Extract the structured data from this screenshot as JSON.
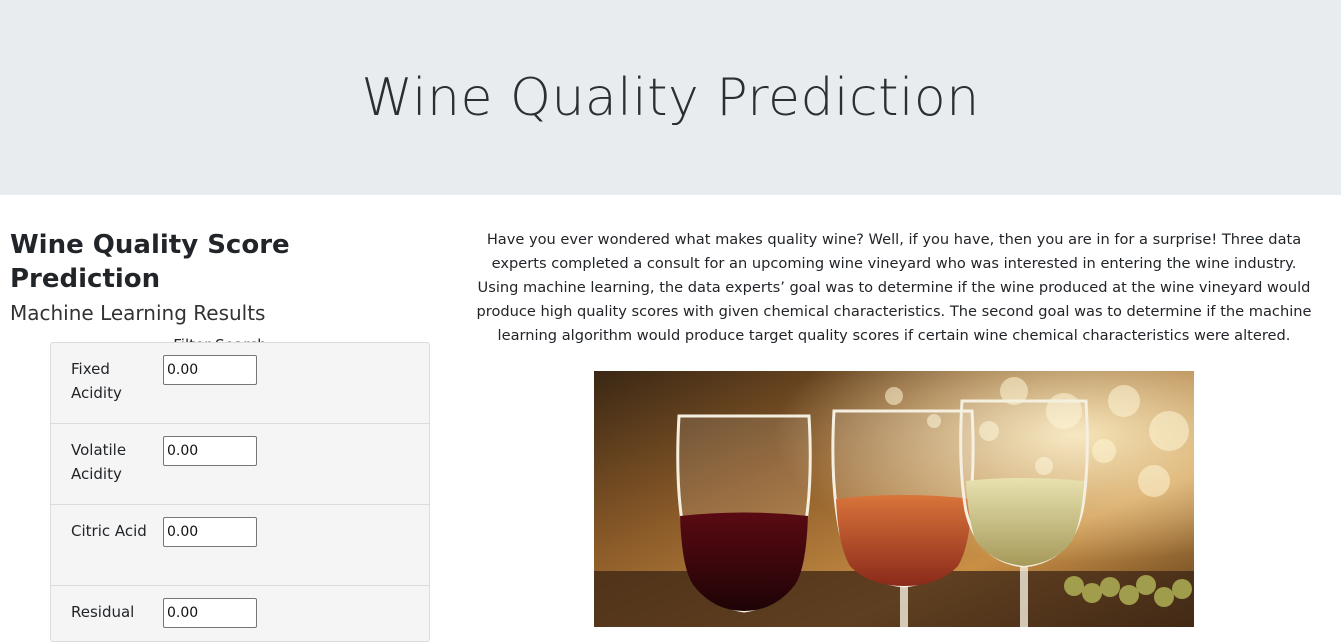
{
  "header": {
    "title": "Wine Quality Prediction"
  },
  "left": {
    "heading": "Wine Quality Score Prediction",
    "subheading": "Machine Learning Results",
    "filter_title": "Filter Search",
    "filters": [
      {
        "label": "Fixed Acidity",
        "value": "0.00"
      },
      {
        "label": "Volatile Acidity",
        "value": "0.00"
      },
      {
        "label": "Citric Acid",
        "value": "0.00"
      },
      {
        "label": "Residual",
        "value": "0.00"
      }
    ]
  },
  "intro": {
    "text": "Have you ever wondered what makes quality wine? Well, if you have, then you are in for a surprise! Three data experts completed a consult for an upcoming wine vineyard who was interested in entering the wine industry. Using machine learning, the data experts’ goal was to determine if the wine produced at the wine vineyard would produce high quality scores with given chemical characteristics. The second goal was to determine if the machine learning algorithm would produce target quality scores if certain wine chemical characteristics were altered."
  },
  "image": {
    "icon": "wine-glasses-image"
  }
}
